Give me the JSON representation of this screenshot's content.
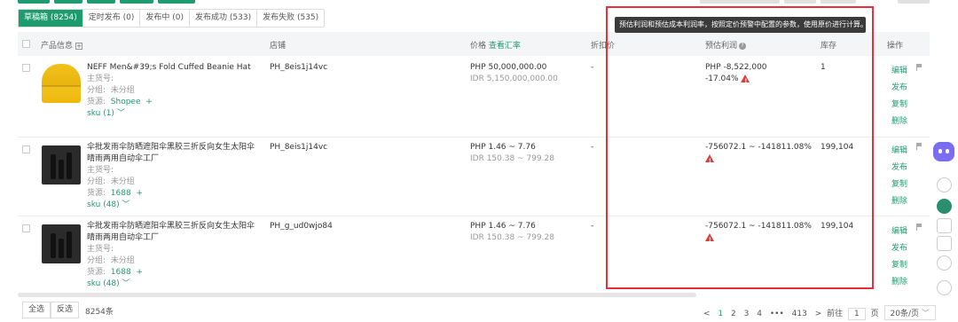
{
  "tabs": [
    {
      "label": "草稿箱 (8254)",
      "active": true
    },
    {
      "label": "定时发布 (0)"
    },
    {
      "label": "发布中 (0)"
    },
    {
      "label": "发布成功 (533)"
    },
    {
      "label": "发布失败 (535)"
    }
  ],
  "header": {
    "product": "产品信息",
    "store": "店铺",
    "price": "价格",
    "exchange_link": "查看汇率",
    "discount": "折扣价",
    "profit": "预估利润",
    "stock": "库存",
    "ops": "操作"
  },
  "tooltip": "预估利润和预估成本利润率，按照定价预警中配置的参数，使用原价进行计算。",
  "labels": {
    "sku_code": "主货号:",
    "group": "分组:",
    "group_value": "未分组",
    "source": "货源:",
    "edit": "编辑",
    "publish": "发布",
    "copy": "复制",
    "delete": "删除"
  },
  "rows": [
    {
      "title": "NEFF Men&#39;s Fold Cuffed Beanie Hat",
      "source_value": "Shopee",
      "sku": "sku (1)",
      "store": "PH_8eis1j14vc",
      "price_php": "PHP 50,000,000.00",
      "price_idr": "IDR 5,150,000,000.00",
      "discount": "-",
      "profit": "PHP -8,522,000",
      "profit_rate": "-17.04%",
      "stock": "1"
    },
    {
      "title": "伞批发雨伞防晒遮阳伞黑胶三折反向女生太阳伞晴雨两用自动伞工厂",
      "source_value": "1688",
      "sku": "sku (48)",
      "store": "PH_8eis1j14vc",
      "price_php": "PHP 1.46 ~ 7.76",
      "price_idr": "IDR 150.38 ~ 799.28",
      "discount": "-",
      "profit": "-756072.1 ~ -141811.08%",
      "profit_rate": "",
      "stock": "199,104"
    },
    {
      "title": "伞批发雨伞防晒遮阳伞黑胶三折反向女生太阳伞晴雨两用自动伞工厂",
      "source_value": "1688",
      "sku": "sku (48)",
      "store": "PH_g_ud0wjo84",
      "price_php": "PHP 1.46 ~ 7.76",
      "price_idr": "IDR 150.38 ~ 799.28",
      "discount": "-",
      "profit": "-756072.1 ~ -141811.08%",
      "profit_rate": "",
      "stock": "199,104"
    }
  ],
  "footer": {
    "select_all": "全选",
    "invert": "反选",
    "total": "8254条",
    "pages": [
      "1",
      "2",
      "3",
      "4",
      "•••",
      "413"
    ],
    "goto": "前往",
    "page_input": "1",
    "page_unit": "页",
    "page_size": "20条/页"
  },
  "colors": {
    "accent": "#1f9c6f",
    "warning": "#e33c3c",
    "highlight": "#e8303c"
  }
}
